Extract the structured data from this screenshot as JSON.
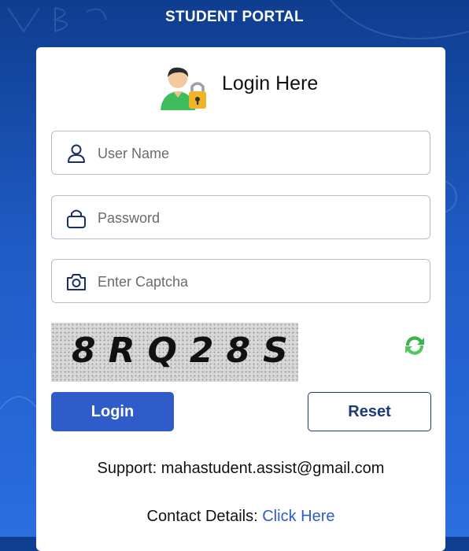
{
  "portal_title": "STUDENT PORTAL",
  "login": {
    "title": "Login Here",
    "avatar_icon": "user-lock-icon"
  },
  "fields": {
    "username": {
      "placeholder": "User Name",
      "icon": "user-icon"
    },
    "password": {
      "placeholder": "Password",
      "icon": "lock-icon"
    },
    "captcha_input": {
      "placeholder": "Enter Captcha",
      "icon": "camera-icon"
    }
  },
  "captcha": {
    "text": "8RQ28S",
    "refresh_icon": "refresh-icon"
  },
  "buttons": {
    "login": "Login",
    "reset": "Reset"
  },
  "support": {
    "text": "Support: mahastudent.assist@gmail.com"
  },
  "contact": {
    "label": "Contact Details: ",
    "link": "Click Here"
  },
  "colors": {
    "primary": "#2f5cc8",
    "background_top": "#0f3d8f",
    "background_bottom": "#2a6ee0"
  }
}
